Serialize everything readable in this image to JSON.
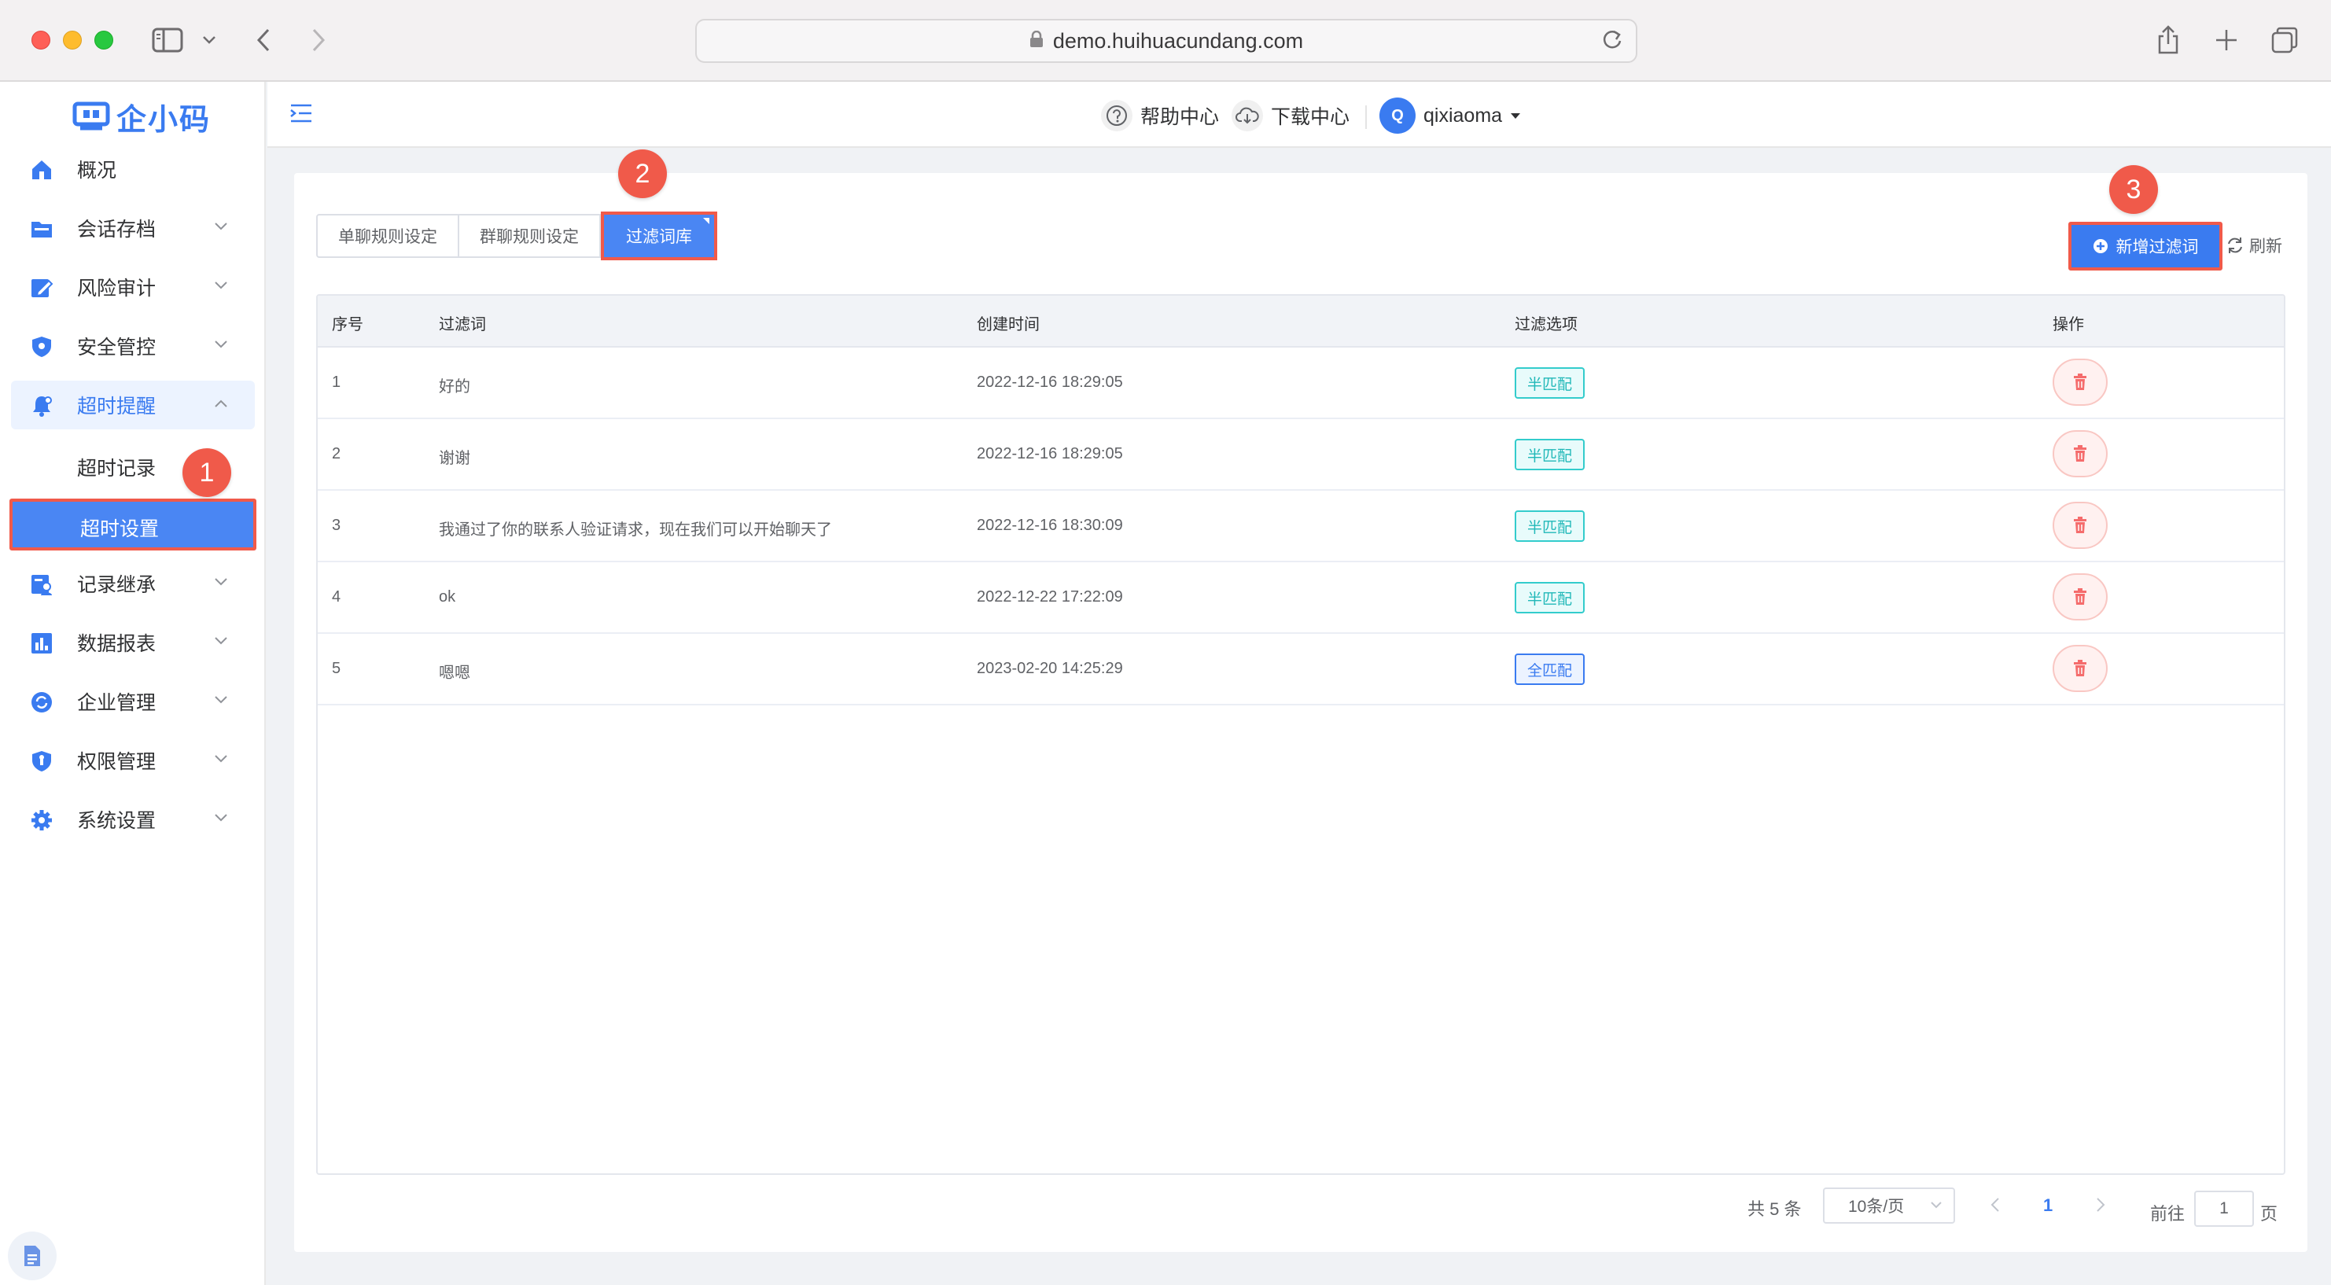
{
  "browser": {
    "url": "demo.huihuacundang.com"
  },
  "logo": {
    "text": "企小码"
  },
  "sidebar": {
    "items": [
      {
        "label": "概况",
        "icon": "home-icon"
      },
      {
        "label": "会话存档",
        "icon": "folder-icon"
      },
      {
        "label": "风险审计",
        "icon": "edit-icon"
      },
      {
        "label": "安全管控",
        "icon": "shield-icon"
      },
      {
        "label": "超时提醒",
        "icon": "bell-icon"
      },
      {
        "label": "记录继承",
        "icon": "user-record-icon"
      },
      {
        "label": "数据报表",
        "icon": "bar-chart-icon"
      },
      {
        "label": "企业管理",
        "icon": "refresh-circle-icon"
      },
      {
        "label": "权限管理",
        "icon": "lock-shield-icon"
      },
      {
        "label": "系统设置",
        "icon": "gear-icon"
      }
    ],
    "sub_items": [
      {
        "label": "超时记录"
      },
      {
        "label": "超时设置"
      }
    ]
  },
  "header": {
    "help": "帮助中心",
    "download": "下载中心",
    "avatar_letter": "Q",
    "username": "qixiaoma"
  },
  "tabs": [
    {
      "label": "单聊规则设定"
    },
    {
      "label": "群聊规则设定"
    },
    {
      "label": "过滤词库"
    }
  ],
  "toolbar": {
    "add_label": "新增过滤词",
    "refresh_label": "刷新"
  },
  "table": {
    "columns": [
      "序号",
      "过滤词",
      "创建时间",
      "过滤选项",
      "操作"
    ],
    "rows": [
      {
        "index": "1",
        "word": "好的",
        "created": "2022-12-16 18:29:05",
        "option": "半匹配"
      },
      {
        "index": "2",
        "word": "谢谢",
        "created": "2022-12-16 18:29:05",
        "option": "半匹配"
      },
      {
        "index": "3",
        "word": "我通过了你的联系人验证请求，现在我们可以开始聊天了",
        "created": "2022-12-16 18:30:09",
        "option": "半匹配"
      },
      {
        "index": "4",
        "word": "ok",
        "created": "2022-12-22 17:22:09",
        "option": "半匹配"
      },
      {
        "index": "5",
        "word": "嗯嗯",
        "created": "2023-02-20 14:25:29",
        "option": "全匹配"
      }
    ]
  },
  "pagination": {
    "total": "共 5 条",
    "page_size": "10条/页",
    "current": "1",
    "goto_label": "前往",
    "goto_value": "1",
    "page_suffix": "页"
  },
  "steps": [
    "1",
    "2",
    "3"
  ],
  "colors": {
    "primary": "#3a7bf0",
    "highlight": "#f05a4a",
    "half_match": "#21b8b8"
  }
}
